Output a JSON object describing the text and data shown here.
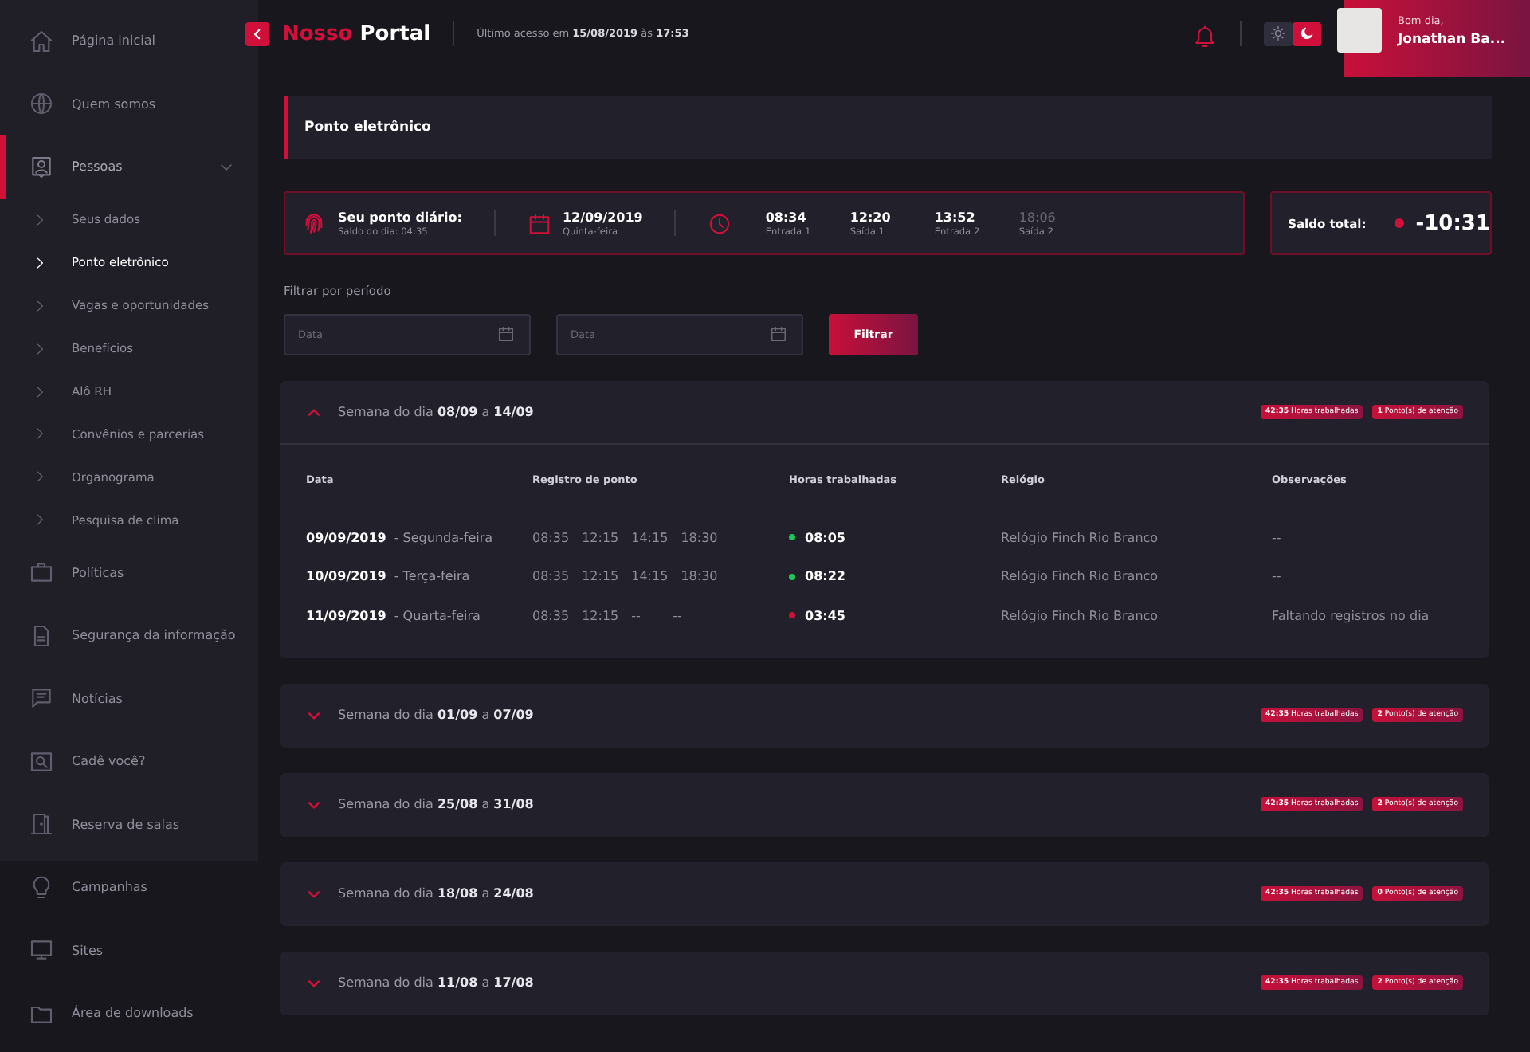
{
  "sidebar": {
    "items": [
      {
        "label": "Página inicial",
        "selected": false
      },
      {
        "label": "Quem somos",
        "selected": false
      },
      {
        "label": "Pessoas",
        "selected": true,
        "expanded": true,
        "children": [
          {
            "label": "Seus dados",
            "selected": false
          },
          {
            "label": "Ponto eletrônico",
            "selected": true
          },
          {
            "label": "Vagas e oportunidades",
            "selected": false
          },
          {
            "label": "Benefícios",
            "selected": false
          },
          {
            "label": "Alô RH",
            "selected": false
          },
          {
            "label": "Convênios e parcerias",
            "selected": false
          },
          {
            "label": "Organograma",
            "selected": false
          },
          {
            "label": "Pesquisa de clima",
            "selected": false
          }
        ]
      },
      {
        "label": "Políticas",
        "selected": false
      },
      {
        "label": "Segurança da informação",
        "selected": false
      },
      {
        "label": "Notícias",
        "selected": false
      },
      {
        "label": "Cadê você?",
        "selected": false
      },
      {
        "label": "Reserva de salas",
        "selected": false
      },
      {
        "label": "Campanhas",
        "selected": false
      },
      {
        "label": "Sites",
        "selected": false
      },
      {
        "label": "Área de downloads",
        "selected": false
      }
    ]
  },
  "header": {
    "brand_first": "Nosso",
    "brand_second": "Portal",
    "last_access": "Último acesso em **15/08/2019** às **17:53**",
    "theme": [
      {
        "kind": "light",
        "selected": false
      },
      {
        "kind": "dark",
        "selected": true
      }
    ],
    "user": {
      "greeting": "Bom dia,",
      "name": "Jonathan Ba..."
    }
  },
  "page_title": "Ponto eletrônico",
  "daily": {
    "title": "Seu ponto diário:",
    "subtitle": "Saldo do dia: 04:35",
    "date": "12/09/2019",
    "weekday": "Quinta-feira",
    "punches": [
      {
        "time": "08:34",
        "label": "Entrada 1",
        "done": true
      },
      {
        "time": "12:20",
        "label": "Saída 1",
        "done": true
      },
      {
        "time": "13:52",
        "label": "Entrada 2",
        "done": true
      },
      {
        "time": "18:06",
        "label": "Saída 2",
        "done": false
      }
    ]
  },
  "balance": {
    "label": "Saldo total:",
    "value": "-10:31",
    "negative": true
  },
  "filter": {
    "label": "Filtrar por período",
    "fields": [
      {
        "placeholder": "Data"
      },
      {
        "placeholder": "Data"
      }
    ],
    "button": "Filtrar"
  },
  "weeks": [
    {
      "title": "Semana do dia **08/09** a **14/09**",
      "expanded": true,
      "hours_badge": "**42:35** Horas trabalhadas",
      "attention_badge": "**1** Ponto(s) de atenção",
      "table": {
        "columns": [
          "Data",
          "Registro de ponto",
          "Horas trabalhadas",
          "Relógio",
          "Observações"
        ],
        "rows": [
          {
            "date": "09/09/2019",
            "weekday": "- Segunda-feira",
            "punches": [
              "08:35",
              "12:15",
              "14:15",
              "18:30"
            ],
            "hours": "08:05",
            "color": "#1fc45a",
            "clock": "Relógio Finch Rio Branco",
            "notes": "--"
          },
          {
            "date": "10/09/2019",
            "weekday": "- Terça-feira",
            "punches": [
              "08:35",
              "12:15",
              "14:15",
              "18:30"
            ],
            "hours": "08:22",
            "color": "#1fc45a",
            "clock": "Relógio Finch Rio Branco",
            "notes": "--"
          },
          {
            "date": "11/09/2019",
            "weekday": "- Quarta-feira",
            "punches": [
              "08:35",
              "12:15",
              "--",
              "--"
            ],
            "hours": "03:45",
            "color": "#d0103a",
            "clock": "Relógio Finch Rio Branco",
            "notes": "Faltando registros no dia"
          }
        ]
      }
    },
    {
      "title": "Semana do dia **01/09** a **07/09**",
      "expanded": false,
      "hours_badge": "**42:35** Horas trabalhadas",
      "attention_badge": "**2** Ponto(s) de atenção"
    },
    {
      "title": "Semana do dia **25/08** a **31/08**",
      "expanded": false,
      "hours_badge": "**42:35** Horas trabalhadas",
      "attention_badge": "**2** Ponto(s) de atenção"
    },
    {
      "title": "Semana do dia **18/08** a **24/08**",
      "expanded": false,
      "hours_badge": "**42:35** Horas trabalhadas",
      "attention_badge": "**0** Ponto(s) de atenção"
    },
    {
      "title": "Semana do dia **11/08** a **17/08**",
      "expanded": false,
      "hours_badge": "**42:35** Horas trabalhadas",
      "attention_badge": "**2** Ponto(s) de atenção"
    }
  ]
}
